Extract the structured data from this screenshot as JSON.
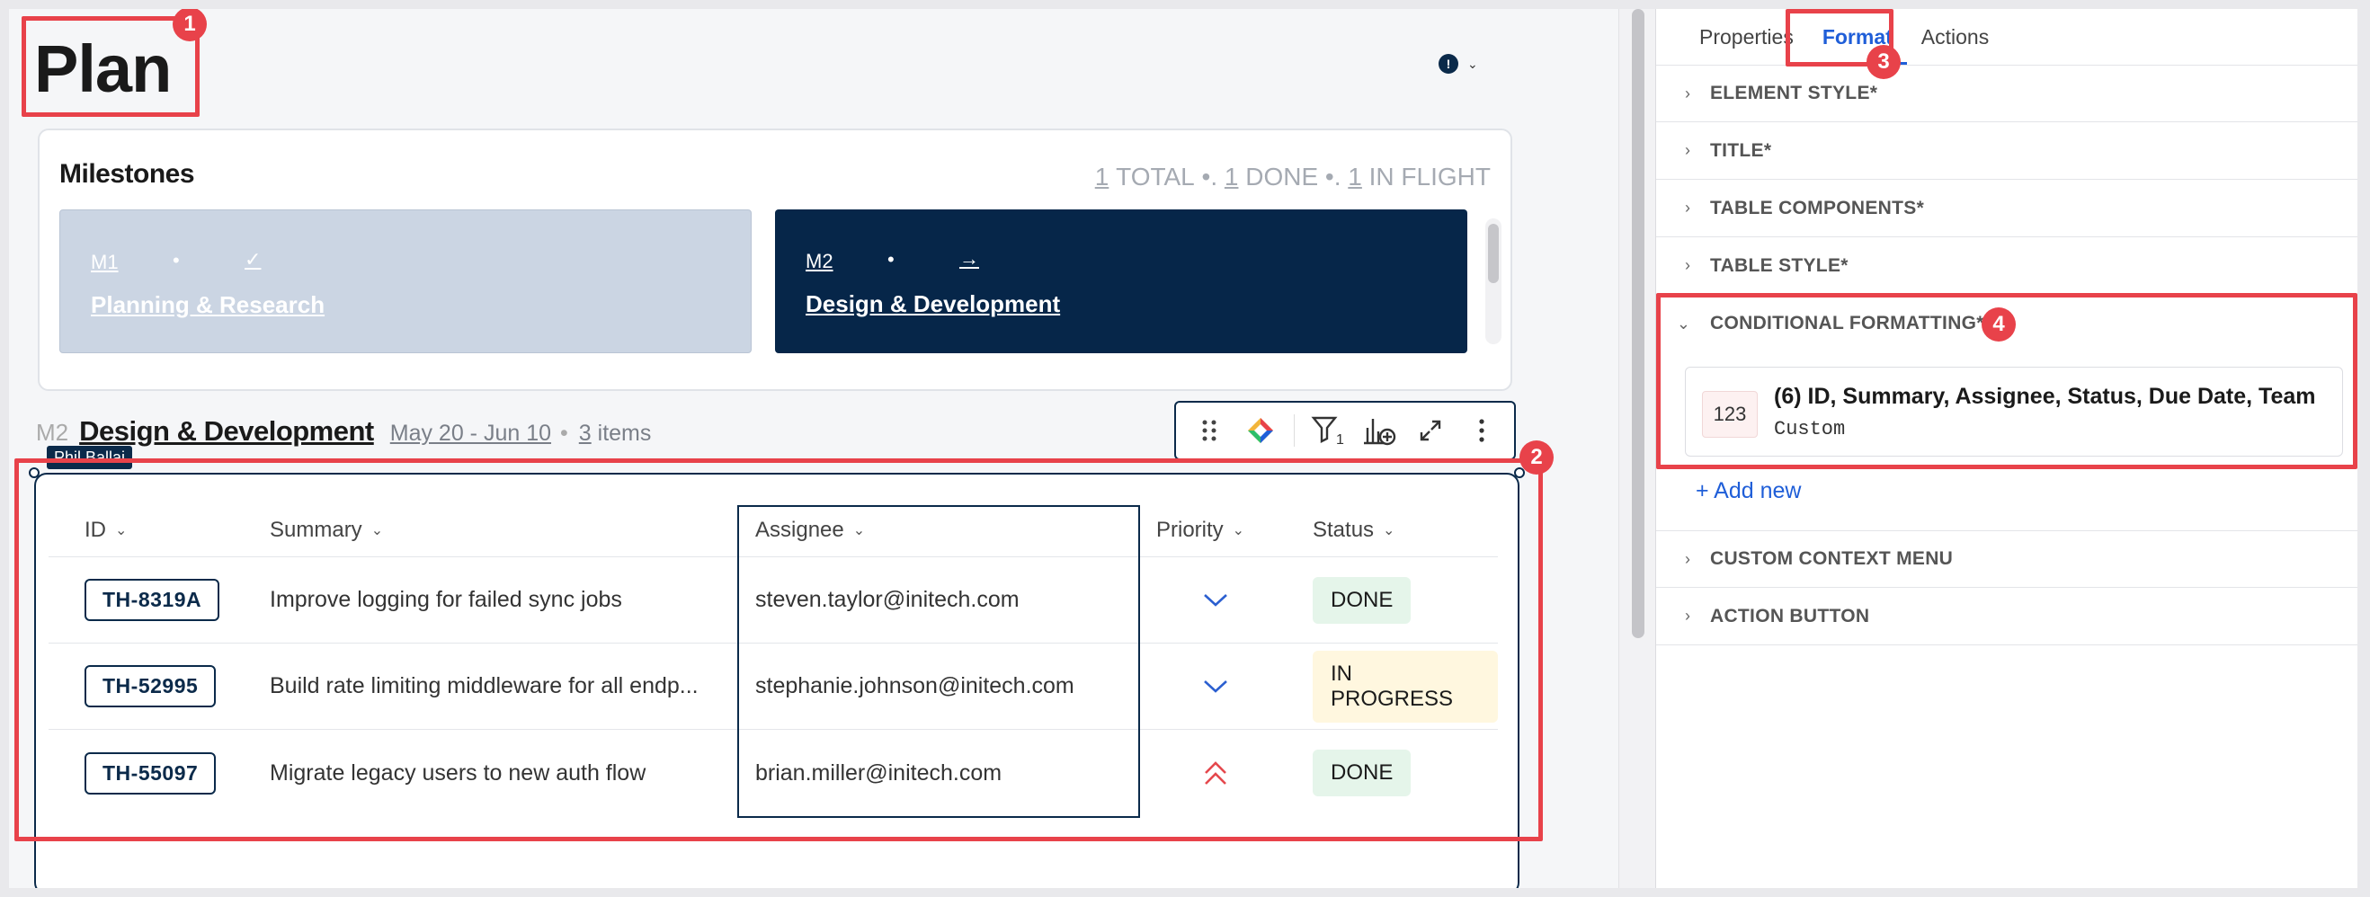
{
  "page": {
    "title": "Plan"
  },
  "user_menu": {
    "avatar_initial": "!",
    "caret": "⌄"
  },
  "milestones": {
    "title": "Milestones",
    "stats": {
      "total_count": "1",
      "total_label": "TOTAL",
      "done_count": "1",
      "done_label": "DONE",
      "inflight_count": "1",
      "inflight_label": "IN FLIGHT",
      "sep": " •. "
    },
    "cards": [
      {
        "code": "M1",
        "bullet": "•",
        "symbol": "✓",
        "name": "Planning & Research"
      },
      {
        "code": "M2",
        "bullet": "•",
        "symbol": "→",
        "name": "Design & Development"
      }
    ]
  },
  "section": {
    "code": "M2",
    "name": "Design & Development",
    "dates": "May 20 - Jun 10",
    "sep": "•",
    "item_count": "3",
    "items_label": "items",
    "tooltip": "Phil Ballai"
  },
  "toolbar": {
    "icons": [
      "drag-icon",
      "smart-icon",
      "filter-icon",
      "chart-add-icon",
      "expand-icon",
      "more-icon"
    ],
    "filter_count": "1"
  },
  "table": {
    "columns": [
      "ID",
      "Summary",
      "Assignee",
      "Priority",
      "Status"
    ],
    "rows": [
      {
        "id": "TH-8319A",
        "summary": "Improve logging for failed sync jobs",
        "assignee": "steven.taylor@initech.com",
        "priority": "low",
        "status": "DONE"
      },
      {
        "id": "TH-52995",
        "summary": "Build rate limiting middleware for all endp...",
        "assignee": "stephanie.johnson@initech.com",
        "priority": "low",
        "status": "IN PROGRESS"
      },
      {
        "id": "TH-55097",
        "summary": "Migrate legacy users to new auth flow",
        "assignee": "brian.miller@initech.com",
        "priority": "high",
        "status": "DONE"
      }
    ]
  },
  "panel": {
    "tabs": [
      "Properties",
      "Format",
      "Actions"
    ],
    "active_tab": "Format",
    "sections": [
      "ELEMENT STYLE*",
      "TITLE*",
      "TABLE COMPONENTS*",
      "TABLE STYLE*",
      "CONDITIONAL FORMATTING*",
      "CUSTOM CONTEXT MENU",
      "ACTION BUTTON"
    ],
    "conditional_rule": {
      "badge": "123",
      "title": "(6) ID, Summary, Assignee, Status, Due Date, Team",
      "type": "Custom"
    },
    "add_new": "+ Add new"
  },
  "annotations": [
    "1",
    "2",
    "3",
    "4"
  ],
  "colors": {
    "accent": "#1f5ed8",
    "navy": "#062649",
    "highlight": "#e8424a"
  }
}
